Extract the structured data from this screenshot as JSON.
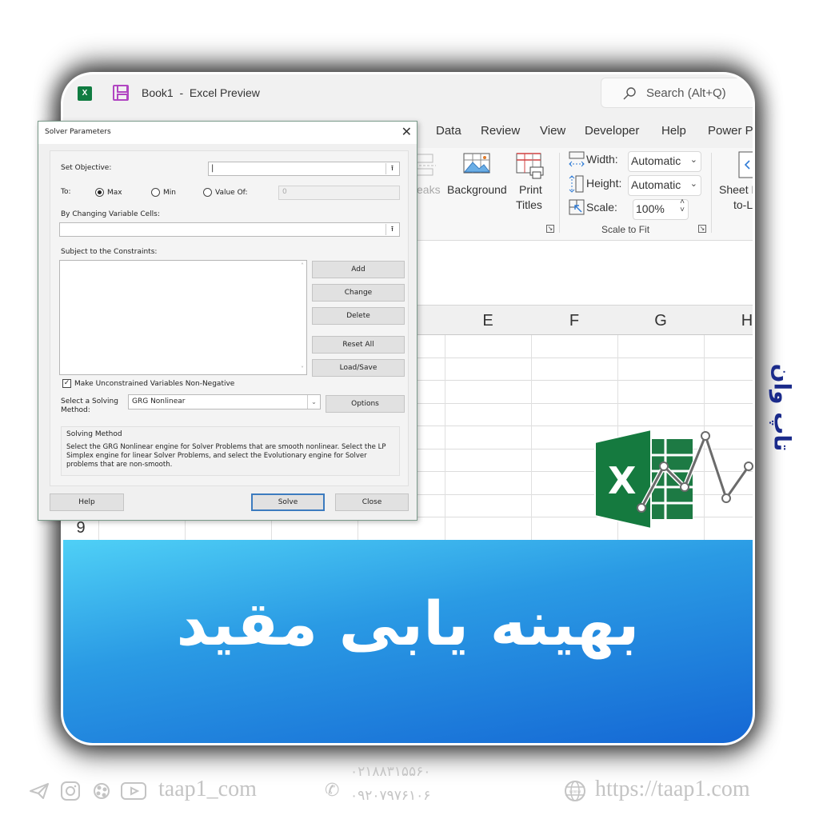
{
  "window": {
    "doc_title": "Book1  -  Excel Preview",
    "app_icon": "excel-icon",
    "save_icon": "save-icon"
  },
  "search": {
    "placeholder": "Search (Alt+Q)",
    "icon": "search-icon"
  },
  "tabs": [
    "Data",
    "Review",
    "View",
    "Developer",
    "Help",
    "Power P"
  ],
  "ribbon": {
    "breaks_label": "eaks",
    "background_label": "Background",
    "print_titles_line1": "Print",
    "print_titles_line2": "Titles",
    "width_label": "Width:",
    "width_value": "Automatic",
    "height_label": "Height:",
    "height_value": "Automatic",
    "scale_label": "Scale:",
    "scale_value": "100%",
    "group_scale_to_fit": "Scale to Fit",
    "sheet_line1": "Sheet F",
    "sheet_line2": "to-L"
  },
  "sheet": {
    "columns": [
      "E",
      "F",
      "G",
      "H"
    ],
    "visible_row_number": "9"
  },
  "solver": {
    "title": "Solver Parameters",
    "set_objective_label": "Set Objective:",
    "set_objective_value": "",
    "to_label": "To:",
    "options": [
      {
        "label": "Max",
        "selected": true
      },
      {
        "label": "Min",
        "selected": false
      },
      {
        "label": "Value Of:",
        "selected": false
      }
    ],
    "value_of_value": "0",
    "changing_cells_label": "By Changing Variable Cells:",
    "changing_cells_value": "",
    "constraints_label": "Subject to the Constraints:",
    "constraints": [],
    "buttons": {
      "add": "Add",
      "change": "Change",
      "delete": "Delete",
      "reset_all": "Reset All",
      "load_save": "Load/Save",
      "options": "Options",
      "help": "Help",
      "solve": "Solve",
      "close": "Close"
    },
    "non_negative_label": "Make Unconstrained Variables Non-Negative",
    "non_negative_checked": true,
    "method_label_line1": "Select a Solving",
    "method_label_line2": "Method:",
    "method_value": "GRG Nonlinear",
    "solving_method_heading": "Solving Method",
    "solving_method_text_1": "Select the GRG Nonlinear engine for Solver Problems that are smooth nonlinear. Select the LP",
    "solving_method_text_2": "Simplex engine for linear Solver Problems, and select the Evolutionary engine for Solver",
    "solving_method_text_3": "problems that are non-smooth."
  },
  "banner": {
    "title": "بهینه یابی مقید"
  },
  "brand": {
    "side_text": "تاپ وان"
  },
  "colors": {
    "excel_green": "#107c41",
    "banner_top": "#4fd0f6",
    "banner_bottom": "#1466d4",
    "brand_navy": "#1a2a8a",
    "solve_border": "#3c7bbf"
  },
  "footer": {
    "social_icons": [
      "telegram-icon",
      "instagram-icon",
      "aparat-icon",
      "youtube-icon"
    ],
    "handle": "taap1_com",
    "phone_1": "۰۲۱۸۸۳۱۵۵۶۰",
    "phone_2": "۰۹۲۰۷۹۷۶۱۰۶",
    "website": "https://taap1.com"
  }
}
